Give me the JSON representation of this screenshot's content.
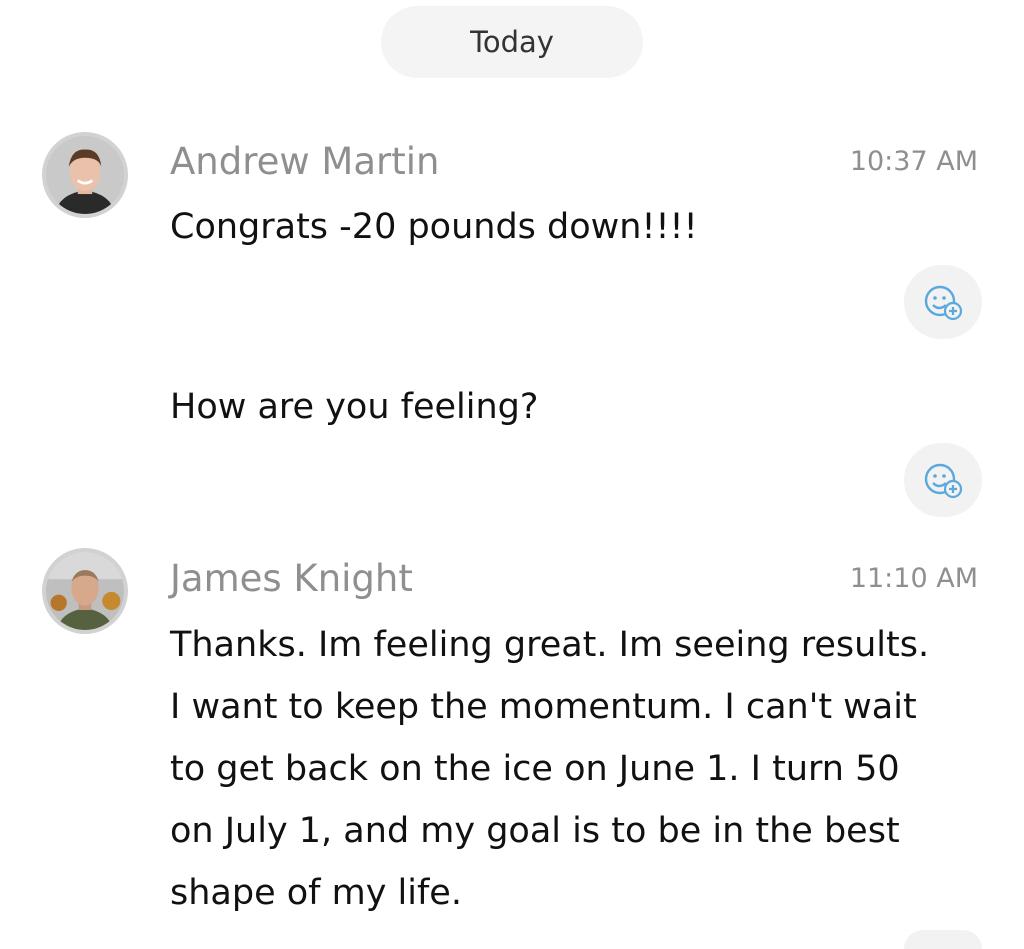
{
  "date_divider": {
    "label": "Today"
  },
  "messages": [
    {
      "sender": "Andrew Martin",
      "time": "10:37 AM",
      "avatar": "avatar-andrew-martin",
      "bubbles": [
        {
          "text": "Congrats -20 pounds down!!!!"
        },
        {
          "text": "How are you feeling?"
        }
      ]
    },
    {
      "sender": "James Knight",
      "time": "11:10 AM",
      "avatar": "avatar-james-knight",
      "lines": [
        "Thanks. Im feeling great. Im seeing results.",
        "I want to keep the momentum. I can't wait",
        "to get back on the ice on June 1. I turn 50",
        "on July 1, and my goal is to be in the best",
        "shape of my life."
      ]
    }
  ],
  "icons": {
    "reaction": "add-reaction-icon"
  },
  "colors": {
    "background": "#ffffff",
    "pill_bg": "#f4f4f4",
    "secondary_text": "#8f8f8f",
    "primary_text": "#111111",
    "reaction_icon": "#5aa9dd"
  }
}
